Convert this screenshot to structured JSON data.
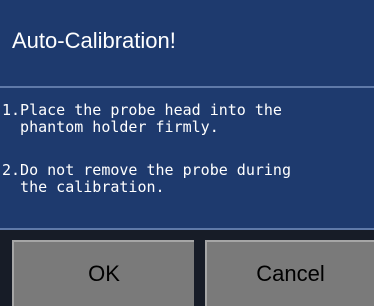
{
  "dialog": {
    "title": "Auto-Calibration!",
    "steps": [
      "1.Place the probe head into the\n  phantom holder firmly.",
      "2.Do not remove the probe during\n  the calibration."
    ],
    "buttons": {
      "ok_label": "OK",
      "cancel_label": "Cancel"
    }
  },
  "colors": {
    "background": "#1e3a6e",
    "divider": "#5f79a8",
    "button": "#7a7a7a",
    "text": "#ffffff"
  }
}
